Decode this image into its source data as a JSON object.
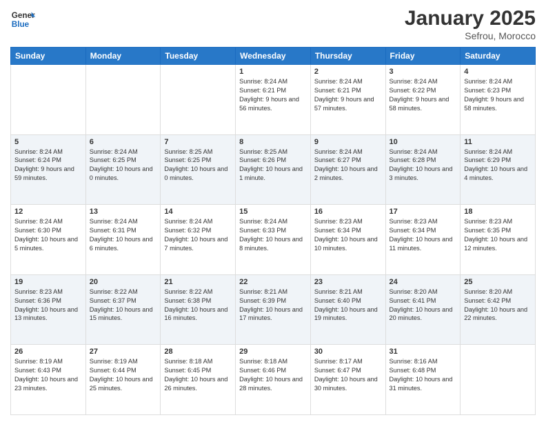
{
  "header": {
    "logo_general": "General",
    "logo_blue": "Blue",
    "title": "January 2025",
    "subtitle": "Sefrou, Morocco"
  },
  "weekdays": [
    "Sunday",
    "Monday",
    "Tuesday",
    "Wednesday",
    "Thursday",
    "Friday",
    "Saturday"
  ],
  "rows": [
    [
      {
        "day": "",
        "info": ""
      },
      {
        "day": "",
        "info": ""
      },
      {
        "day": "",
        "info": ""
      },
      {
        "day": "1",
        "info": "Sunrise: 8:24 AM\nSunset: 6:21 PM\nDaylight: 9 hours and 56 minutes."
      },
      {
        "day": "2",
        "info": "Sunrise: 8:24 AM\nSunset: 6:21 PM\nDaylight: 9 hours and 57 minutes."
      },
      {
        "day": "3",
        "info": "Sunrise: 8:24 AM\nSunset: 6:22 PM\nDaylight: 9 hours and 58 minutes."
      },
      {
        "day": "4",
        "info": "Sunrise: 8:24 AM\nSunset: 6:23 PM\nDaylight: 9 hours and 58 minutes."
      }
    ],
    [
      {
        "day": "5",
        "info": "Sunrise: 8:24 AM\nSunset: 6:24 PM\nDaylight: 9 hours and 59 minutes."
      },
      {
        "day": "6",
        "info": "Sunrise: 8:24 AM\nSunset: 6:25 PM\nDaylight: 10 hours and 0 minutes."
      },
      {
        "day": "7",
        "info": "Sunrise: 8:25 AM\nSunset: 6:25 PM\nDaylight: 10 hours and 0 minutes."
      },
      {
        "day": "8",
        "info": "Sunrise: 8:25 AM\nSunset: 6:26 PM\nDaylight: 10 hours and 1 minute."
      },
      {
        "day": "9",
        "info": "Sunrise: 8:24 AM\nSunset: 6:27 PM\nDaylight: 10 hours and 2 minutes."
      },
      {
        "day": "10",
        "info": "Sunrise: 8:24 AM\nSunset: 6:28 PM\nDaylight: 10 hours and 3 minutes."
      },
      {
        "day": "11",
        "info": "Sunrise: 8:24 AM\nSunset: 6:29 PM\nDaylight: 10 hours and 4 minutes."
      }
    ],
    [
      {
        "day": "12",
        "info": "Sunrise: 8:24 AM\nSunset: 6:30 PM\nDaylight: 10 hours and 5 minutes."
      },
      {
        "day": "13",
        "info": "Sunrise: 8:24 AM\nSunset: 6:31 PM\nDaylight: 10 hours and 6 minutes."
      },
      {
        "day": "14",
        "info": "Sunrise: 8:24 AM\nSunset: 6:32 PM\nDaylight: 10 hours and 7 minutes."
      },
      {
        "day": "15",
        "info": "Sunrise: 8:24 AM\nSunset: 6:33 PM\nDaylight: 10 hours and 8 minutes."
      },
      {
        "day": "16",
        "info": "Sunrise: 8:23 AM\nSunset: 6:34 PM\nDaylight: 10 hours and 10 minutes."
      },
      {
        "day": "17",
        "info": "Sunrise: 8:23 AM\nSunset: 6:34 PM\nDaylight: 10 hours and 11 minutes."
      },
      {
        "day": "18",
        "info": "Sunrise: 8:23 AM\nSunset: 6:35 PM\nDaylight: 10 hours and 12 minutes."
      }
    ],
    [
      {
        "day": "19",
        "info": "Sunrise: 8:23 AM\nSunset: 6:36 PM\nDaylight: 10 hours and 13 minutes."
      },
      {
        "day": "20",
        "info": "Sunrise: 8:22 AM\nSunset: 6:37 PM\nDaylight: 10 hours and 15 minutes."
      },
      {
        "day": "21",
        "info": "Sunrise: 8:22 AM\nSunset: 6:38 PM\nDaylight: 10 hours and 16 minutes."
      },
      {
        "day": "22",
        "info": "Sunrise: 8:21 AM\nSunset: 6:39 PM\nDaylight: 10 hours and 17 minutes."
      },
      {
        "day": "23",
        "info": "Sunrise: 8:21 AM\nSunset: 6:40 PM\nDaylight: 10 hours and 19 minutes."
      },
      {
        "day": "24",
        "info": "Sunrise: 8:20 AM\nSunset: 6:41 PM\nDaylight: 10 hours and 20 minutes."
      },
      {
        "day": "25",
        "info": "Sunrise: 8:20 AM\nSunset: 6:42 PM\nDaylight: 10 hours and 22 minutes."
      }
    ],
    [
      {
        "day": "26",
        "info": "Sunrise: 8:19 AM\nSunset: 6:43 PM\nDaylight: 10 hours and 23 minutes."
      },
      {
        "day": "27",
        "info": "Sunrise: 8:19 AM\nSunset: 6:44 PM\nDaylight: 10 hours and 25 minutes."
      },
      {
        "day": "28",
        "info": "Sunrise: 8:18 AM\nSunset: 6:45 PM\nDaylight: 10 hours and 26 minutes."
      },
      {
        "day": "29",
        "info": "Sunrise: 8:18 AM\nSunset: 6:46 PM\nDaylight: 10 hours and 28 minutes."
      },
      {
        "day": "30",
        "info": "Sunrise: 8:17 AM\nSunset: 6:47 PM\nDaylight: 10 hours and 30 minutes."
      },
      {
        "day": "31",
        "info": "Sunrise: 8:16 AM\nSunset: 6:48 PM\nDaylight: 10 hours and 31 minutes."
      },
      {
        "day": "",
        "info": ""
      }
    ]
  ]
}
